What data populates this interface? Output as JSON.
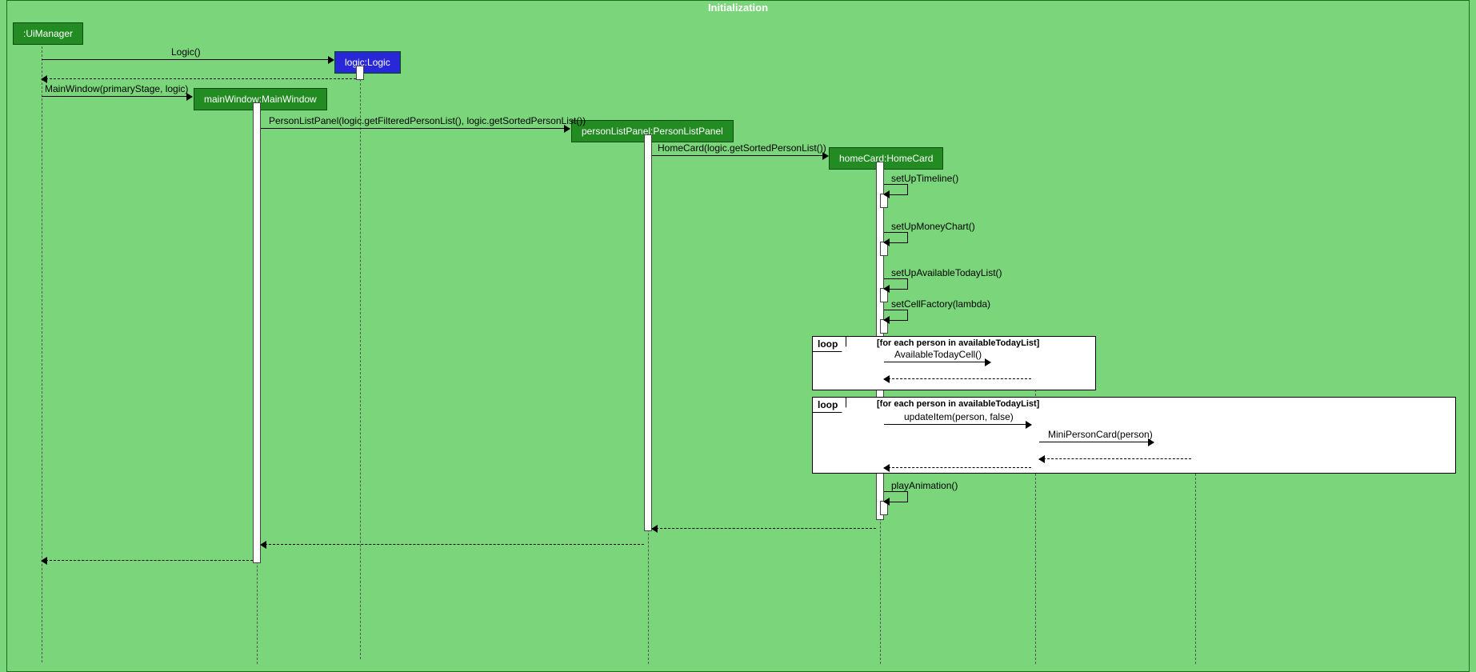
{
  "sd": {
    "title": "Initialization",
    "participants": {
      "uiManager": ":UiManager",
      "logic": "logic:Logic",
      "mainWindow": "mainWindow:MainWindow",
      "personListPanel": "personListPanel:PersonListPanel",
      "homeCard": "homeCard:HomeCard",
      "availableTodayCell": "AvailableTodayCell",
      "miniPersonCard": "MiniPersonCard"
    },
    "messages": {
      "m1": "Logic()",
      "m2": "MainWindow(primaryStage, logic)",
      "m3": "PersonListPanel(logic.getFilteredPersonList(), logic.getSortedPersonList())",
      "m4": "HomeCard(logic.getSortedPersonList())",
      "m5": "setUpTimeline()",
      "m6": "setUpMoneyChart()",
      "m7": "setUpAvailableTodayList()",
      "m8": "setCellFactory(lambda)",
      "m9": "AvailableTodayCell()",
      "m10": "updateItem(person, false)",
      "m11": "MiniPersonCard(person)",
      "m12": "playAnimation()"
    },
    "loops": {
      "tag1": "loop",
      "guard1": "[for each person in availableTodayList]",
      "tag2": "loop",
      "guard2": "[for each person in availableTodayList]"
    }
  }
}
